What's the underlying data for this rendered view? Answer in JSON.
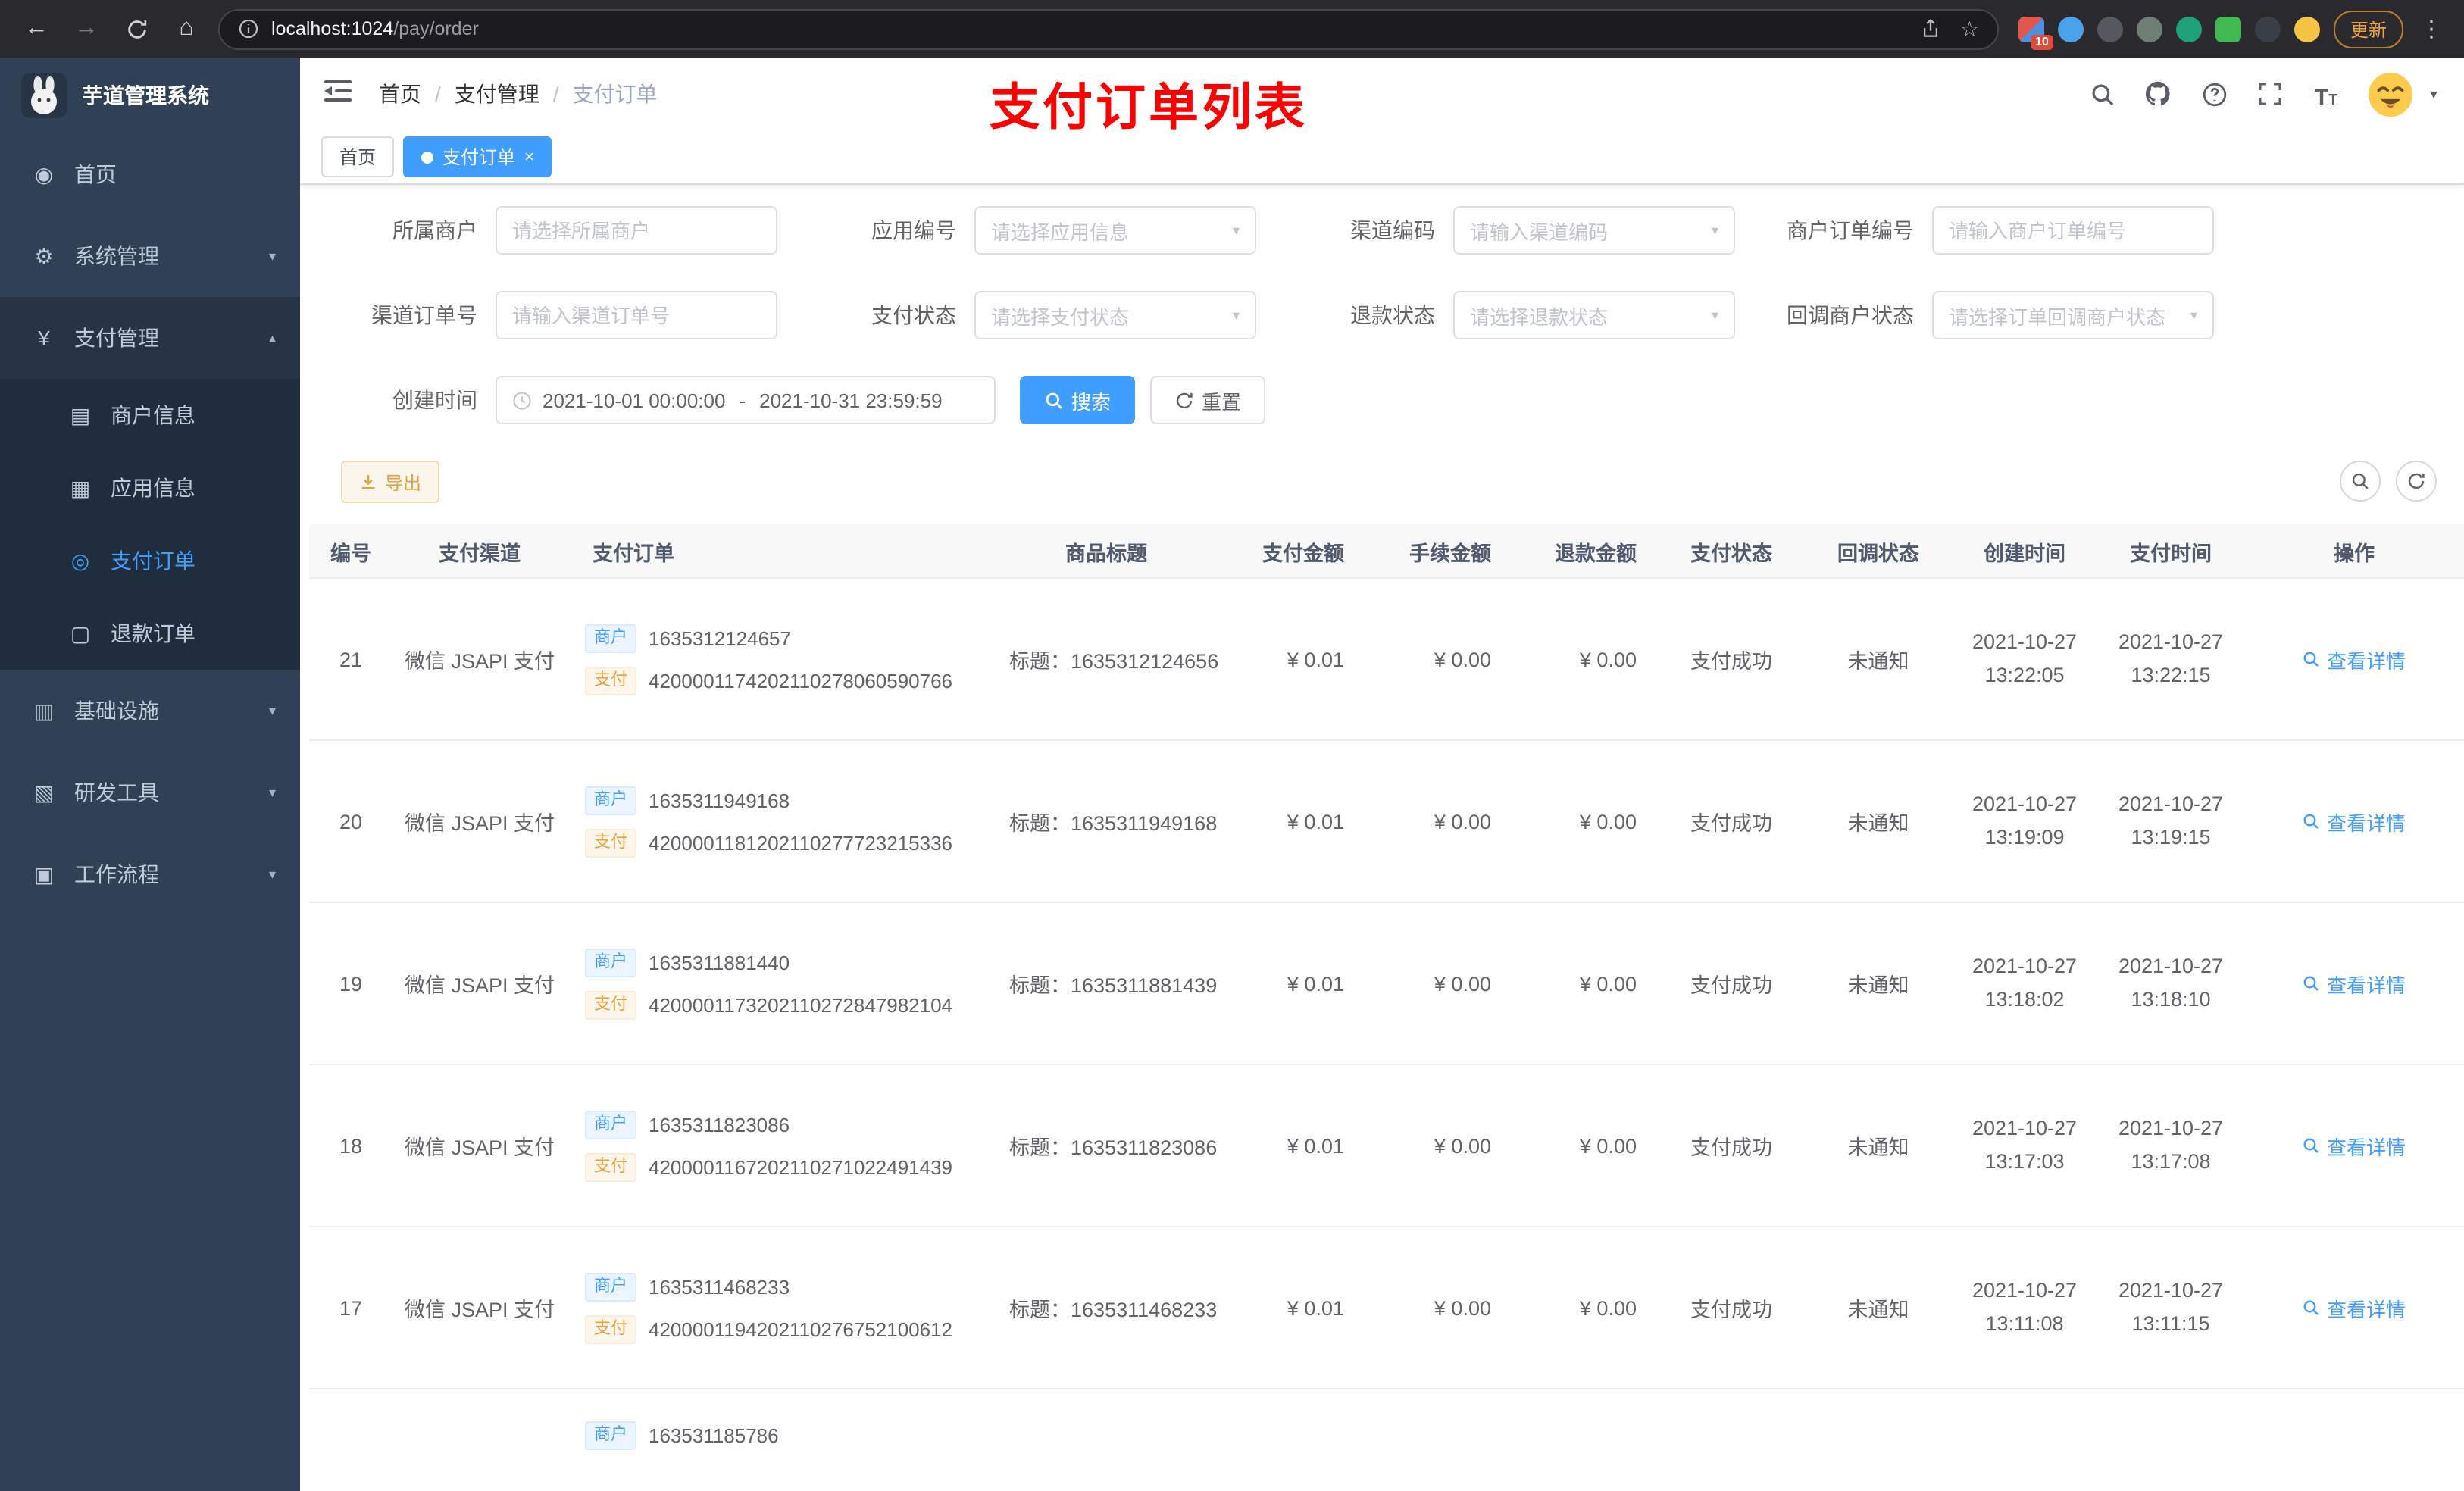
{
  "browser": {
    "url_host": "localhost:1024",
    "url_path": "/pay/order",
    "extensions_badge": "10",
    "update_label": "更新"
  },
  "app": {
    "title": "芋道管理系统",
    "annotation": "支付订单列表"
  },
  "breadcrumb": {
    "items": [
      "首页",
      "支付管理",
      "支付订单"
    ],
    "separator": "/"
  },
  "tabs": {
    "home": "首页",
    "active": "支付订单",
    "close": "×"
  },
  "icons": {
    "dashboard": "◉",
    "system": "⚙",
    "payment": "¥",
    "merchant": "▤",
    "application": "▦",
    "pay_order": "◎",
    "refund_order": "▢",
    "infrastructure": "▥",
    "dev_tools": "▧",
    "workflow": "▣",
    "arrow_down": "▾",
    "arrow_up": "▴",
    "caret_down": "▼",
    "back": "←",
    "forward": "→",
    "home": "⌂",
    "star": "☆",
    "menu_dots": "⋮"
  },
  "sidebar": {
    "menu": [
      {
        "label": "首页"
      },
      {
        "label": "系统管理"
      },
      {
        "label": "支付管理"
      },
      {
        "label": "基础设施"
      },
      {
        "label": "研发工具"
      },
      {
        "label": "工作流程"
      }
    ],
    "payment_submenu": [
      {
        "label": "商户信息"
      },
      {
        "label": "应用信息"
      },
      {
        "label": "支付订单"
      },
      {
        "label": "退款订单"
      }
    ]
  },
  "search_form": {
    "fields": [
      {
        "label": "所属商户",
        "placeholder": "请选择所属商户"
      },
      {
        "label": "应用编号",
        "placeholder": "请选择应用信息"
      },
      {
        "label": "渠道编码",
        "placeholder": "请输入渠道编码"
      },
      {
        "label": "商户订单编号",
        "placeholder": "请输入商户订单编号"
      },
      {
        "label": "渠道订单号",
        "placeholder": "请输入渠道订单号"
      },
      {
        "label": "支付状态",
        "placeholder": "请选择支付状态"
      },
      {
        "label": "退款状态",
        "placeholder": "请选择退款状态"
      },
      {
        "label": "回调商户状态",
        "placeholder": "请选择订单回调商户状态"
      }
    ],
    "date_label": "创建时间",
    "date_start": "2021-10-01 00:00:00",
    "date_separator": "-",
    "date_end": "2021-10-31 23:59:59",
    "search_label": "搜索",
    "reset_label": "重置"
  },
  "toolbar": {
    "export_label": "导出"
  },
  "table": {
    "columns": [
      "编号",
      "支付渠道",
      "支付订单",
      "商品标题",
      "支付金额",
      "手续金额",
      "退款金额",
      "支付状态",
      "回调状态",
      "创建时间",
      "支付时间",
      "操作"
    ],
    "merchant_tag": "商户",
    "pay_tag": "支付",
    "action_label": "查看详情",
    "rows": [
      {
        "id": "21",
        "channel": "微信 JSAPI 支付",
        "merchant_no": "1635312124657",
        "pay_no": "4200001174202110278060590766",
        "title": "标题：1635312124656",
        "amount": "¥ 0.01",
        "fee": "¥ 0.00",
        "refund": "¥ 0.00",
        "status": "支付成功",
        "notify_status": "未通知",
        "create_date": "2021-10-27",
        "create_time": "13:22:05",
        "pay_date": "2021-10-27",
        "pay_time": "13:22:15"
      },
      {
        "id": "20",
        "channel": "微信 JSAPI 支付",
        "merchant_no": "1635311949168",
        "pay_no": "4200001181202110277723215336",
        "title": "标题：1635311949168",
        "amount": "¥ 0.01",
        "fee": "¥ 0.00",
        "refund": "¥ 0.00",
        "status": "支付成功",
        "notify_status": "未通知",
        "create_date": "2021-10-27",
        "create_time": "13:19:09",
        "pay_date": "2021-10-27",
        "pay_time": "13:19:15"
      },
      {
        "id": "19",
        "channel": "微信 JSAPI 支付",
        "merchant_no": "1635311881440",
        "pay_no": "4200001173202110272847982104",
        "title": "标题：1635311881439",
        "amount": "¥ 0.01",
        "fee": "¥ 0.00",
        "refund": "¥ 0.00",
        "status": "支付成功",
        "notify_status": "未通知",
        "create_date": "2021-10-27",
        "create_time": "13:18:02",
        "pay_date": "2021-10-27",
        "pay_time": "13:18:10"
      },
      {
        "id": "18",
        "channel": "微信 JSAPI 支付",
        "merchant_no": "1635311823086",
        "pay_no": "4200001167202110271022491439",
        "title": "标题：1635311823086",
        "amount": "¥ 0.01",
        "fee": "¥ 0.00",
        "refund": "¥ 0.00",
        "status": "支付成功",
        "notify_status": "未通知",
        "create_date": "2021-10-27",
        "create_time": "13:17:03",
        "pay_date": "2021-10-27",
        "pay_time": "13:17:08"
      },
      {
        "id": "17",
        "channel": "微信 JSAPI 支付",
        "merchant_no": "1635311468233",
        "pay_no": "4200001194202110276752100612",
        "title": "标题：1635311468233",
        "amount": "¥ 0.01",
        "fee": "¥ 0.00",
        "refund": "¥ 0.00",
        "status": "支付成功",
        "notify_status": "未通知",
        "create_date": "2021-10-27",
        "create_time": "13:11:08",
        "pay_date": "2021-10-27",
        "pay_time": "13:11:15"
      }
    ],
    "partial_row": {
      "merchant_no": "163531185786"
    }
  }
}
